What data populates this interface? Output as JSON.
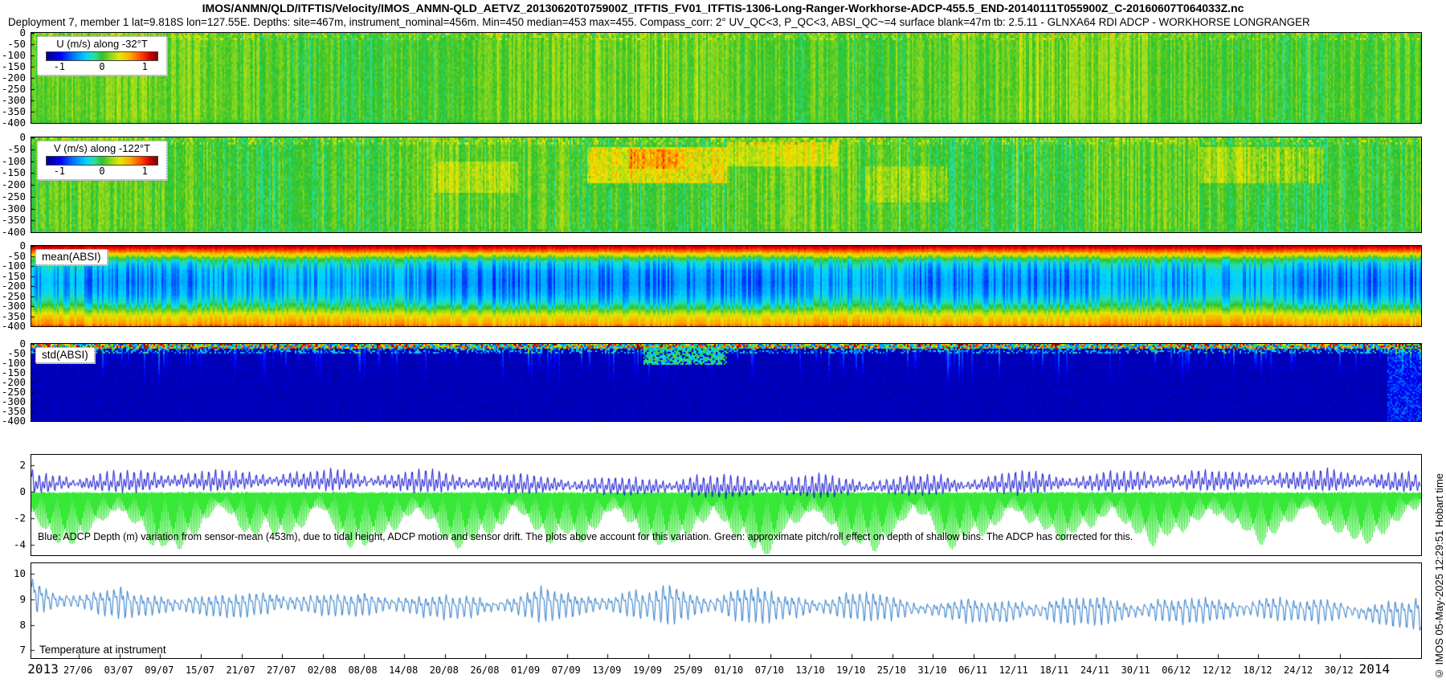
{
  "header": {
    "title": "IMOS/ANMN/QLD/ITFTIS/Velocity/IMOS_ANMN-QLD_AETVZ_20130620T075900Z_ITFTIS_FV01_ITFTIS-1306-Long-Ranger-Workhorse-ADCP-455.5_END-20140111T055900Z_C-20160607T064033Z.nc",
    "subtitle": "Deployment 7, member 1 lat=9.818S lon=127.55E. Depths: site=467m, instrument_nominal=456m. Min=450 median=453 max=455. Compass_corr: 2° UV_QC<3, P_QC<3, ABSI_QC~=4 surface blank=47m tb: 2.5.11 - GLNXA64 RDI ADCP - WORKHORSE LONGRANGER"
  },
  "watermark": "© IMOS 05-May-2025 12:29:51 Hobart time",
  "colors": {
    "jet_stops": [
      [
        0,
        "#000083"
      ],
      [
        0.125,
        "#0000ff"
      ],
      [
        0.25,
        "#0080ff"
      ],
      [
        0.36,
        "#00d5ff"
      ],
      [
        0.43,
        "#2ae0a0"
      ],
      [
        0.5,
        "#2cc22c"
      ],
      [
        0.58,
        "#8fd81e"
      ],
      [
        0.66,
        "#e8e800"
      ],
      [
        0.76,
        "#ffa500"
      ],
      [
        0.86,
        "#ff3c00"
      ],
      [
        0.93,
        "#d40000"
      ],
      [
        1,
        "#800000"
      ]
    ],
    "depth_blue": "#0a0ad2",
    "pitchroll_green": "#37e837",
    "temperature_blue": "#2878c8"
  },
  "x_axis": {
    "year_start": "2013",
    "year_end": "2014",
    "start_date": "2013-06-20",
    "end_date": "2014-01-11",
    "span_days": 205,
    "first_tick_day": 7,
    "tick_step_days": 6,
    "tick_labels": [
      "27/06",
      "03/07",
      "09/07",
      "15/07",
      "21/07",
      "27/07",
      "02/08",
      "08/08",
      "14/08",
      "20/08",
      "26/08",
      "01/09",
      "07/09",
      "13/09",
      "19/09",
      "25/09",
      "01/10",
      "07/10",
      "13/10",
      "19/10",
      "25/10",
      "31/10",
      "06/11",
      "12/11",
      "18/11",
      "24/11",
      "30/11",
      "06/12",
      "12/12",
      "18/12",
      "24/12",
      "30/12"
    ]
  },
  "chart_data": [
    {
      "type": "heatmap",
      "title": "U (m/s) along -32°T",
      "colorbar_ticks": [
        "-1",
        "0",
        "1"
      ],
      "value_range": [
        -1,
        1
      ],
      "colormap": "jet",
      "ylim": [
        -400,
        0
      ],
      "ytick_labels": [
        "0",
        "-50",
        "-100",
        "-150",
        "-200",
        "-250",
        "-300",
        "-350",
        "-400"
      ],
      "summary": "Along-shelf velocity vs depth and time; mostly 0 to +0.3 m/s (green to yellow-green) with dense tidal vertical banding and yellow speckle in the upper 30 m",
      "texture": {
        "mean": 0.06,
        "lowAmp": 0.05,
        "lowFreq": 3,
        "colNoise": 0.22,
        "cellNoise": 0.1,
        "surfNoise": 0.5,
        "patches": []
      }
    },
    {
      "type": "heatmap",
      "title": "V (m/s) along -122°T",
      "colorbar_ticks": [
        "-1",
        "0",
        "1"
      ],
      "value_range": [
        -1,
        1
      ],
      "colormap": "jet",
      "ylim": [
        -400,
        0
      ],
      "ytick_labels": [
        "0",
        "-50",
        "-100",
        "-150",
        "-200",
        "-250",
        "-300",
        "-350",
        "-400"
      ],
      "summary": "Cross-shelf velocity; green background with stronger positive (yellow-orange) events mid-record near 19/09-01/10 at 50-250 m and in late November",
      "texture": {
        "mean": 0.03,
        "lowAmp": 0.05,
        "lowFreq": 4,
        "colNoise": 0.24,
        "cellNoise": 0.12,
        "surfNoise": 0.55,
        "patches": [
          {
            "x0": 0.4,
            "x1": 0.5,
            "d0": 0.1,
            "d1": 0.45,
            "dv": 0.4
          },
          {
            "x0": 0.43,
            "x1": 0.47,
            "d0": 0.12,
            "d1": 0.32,
            "dv": 0.25
          },
          {
            "x0": 0.5,
            "x1": 0.58,
            "d0": 0.05,
            "d1": 0.28,
            "dv": 0.25
          },
          {
            "x0": 0.29,
            "x1": 0.35,
            "d0": 0.25,
            "d1": 0.55,
            "dv": 0.18
          },
          {
            "x0": 0.6,
            "x1": 0.66,
            "d0": 0.3,
            "d1": 0.65,
            "dv": 0.15
          },
          {
            "x0": 0.84,
            "x1": 0.93,
            "d0": 0.08,
            "d1": 0.45,
            "dv": 0.22
          }
        ]
      }
    },
    {
      "type": "heatmap",
      "title": "mean(ABSI)",
      "colormap": "jet",
      "ylim": [
        -400,
        0
      ],
      "ytick_labels": [
        "0",
        "-50",
        "-100",
        "-150",
        "-200",
        "-250",
        "-300",
        "-350",
        "-400"
      ],
      "summary": "Mean acoustic backscatter: dark red at surface, yellow-green near 50-80 m, cyan-blue 100-300 m with dark-blue tidal stripes, yellow-orange band 330-390 m, red at instrument depth",
      "texture": {
        "profile": [
          [
            0,
            0.96
          ],
          [
            0.03,
            0.9
          ],
          [
            0.07,
            0.8
          ],
          [
            0.11,
            0.66
          ],
          [
            0.16,
            0.5
          ],
          [
            0.22,
            0.42
          ],
          [
            0.3,
            0.36
          ],
          [
            0.45,
            0.33
          ],
          [
            0.6,
            0.37
          ],
          [
            0.7,
            0.45
          ],
          [
            0.78,
            0.57
          ],
          [
            0.86,
            0.7
          ],
          [
            0.92,
            0.76
          ],
          [
            0.96,
            0.78
          ],
          [
            1,
            0.9
          ]
        ],
        "stripe_frac": 0.45,
        "stripe_amp": 0.13,
        "regions": [
          {
            "x0": 0.04,
            "x1": 0.12,
            "dt": -0.035
          },
          {
            "x0": 0.28,
            "x1": 0.55,
            "dt": -0.05
          },
          {
            "x0": 0.63,
            "x1": 0.76,
            "dt": -0.04
          },
          {
            "x0": 0.9,
            "x1": 1.0,
            "dt": -0.045
          }
        ]
      }
    },
    {
      "type": "heatmap",
      "title": "std(ABSI)",
      "colormap": "jet",
      "ylim": [
        -400,
        0
      ],
      "ytick_labels": [
        "0",
        "-50",
        "-100",
        "-150",
        "-200",
        "-250",
        "-300",
        "-350",
        "-400"
      ],
      "summary": "Std of backscatter: near zero (dark navy) at depth, high variability (red/yellow/green speckle) in the upper 40 m with cyan streaks to ~150 m",
      "texture": {
        "base_t": 0.05,
        "streak_prob": 0.18,
        "patch": {
          "x0": 0.44,
          "x1": 0.5,
          "d0": 0.04,
          "d1": 0.25
        }
      }
    },
    {
      "type": "line",
      "ylim": [
        -4.8,
        2.8
      ],
      "ytick_labels": [
        "2",
        "0",
        "-2",
        "-4"
      ],
      "annotation": "Blue: ADCP Depth (m) variation from sensor-mean (453m), due to tidal height, ADCP motion and sensor drift. The plots above account for this variation. Green: approximate pitch/roll effect on depth of shallow bins. The ADCP has corrected for this.",
      "series": [
        {
          "name": "ADCP depth variation from sensor-mean (m)",
          "color_key": "depth_blue",
          "envelope_x": [
            0,
            0.1,
            0.2,
            0.3,
            0.4,
            0.5,
            0.6,
            0.7,
            0.8,
            0.9,
            1
          ],
          "upper": [
            1.9,
            2.1,
            1.8,
            2.0,
            1.9,
            2.2,
            1.9,
            2.0,
            2.1,
            1.9,
            2.0
          ],
          "lower": [
            -0.4,
            -0.5,
            -0.4,
            -0.5,
            -0.6,
            -0.5,
            -0.4,
            -0.5,
            -0.5,
            -0.4,
            -0.5
          ]
        },
        {
          "name": "approximate pitch/roll effect on depth of shallow bins (m)",
          "color_key": "pitchroll_green",
          "envelope_x": [
            0,
            0.1,
            0.2,
            0.3,
            0.4,
            0.5,
            0.6,
            0.7,
            0.8,
            0.9,
            1
          ],
          "upper": [
            0,
            0,
            0,
            0,
            0,
            0,
            0,
            0,
            0,
            0,
            0
          ],
          "lower": [
            -4.2,
            -4.4,
            -3.8,
            -4.3,
            -4.0,
            -4.4,
            -4.2,
            -3.9,
            -4.3,
            -4.1,
            -4.3
          ]
        }
      ]
    },
    {
      "type": "line",
      "title": "Temperature at instrument",
      "ylim": [
        6.7,
        10.4
      ],
      "ytick_labels": [
        "10",
        "9",
        "8",
        "7"
      ],
      "series": [
        {
          "name": "temperature at instrument (°C)",
          "color_key": "temperature_blue",
          "envelope_x": [
            0,
            0.1,
            0.2,
            0.3,
            0.4,
            0.5,
            0.6,
            0.7,
            0.8,
            0.9,
            1
          ],
          "upper": [
            10.0,
            9.6,
            9.7,
            9.6,
            9.9,
            10.2,
            9.7,
            9.4,
            9.6,
            9.5,
            9.3
          ],
          "lower": [
            8.2,
            8.0,
            8.1,
            8.0,
            7.9,
            7.6,
            7.9,
            7.8,
            7.7,
            7.9,
            7.6
          ]
        }
      ]
    }
  ]
}
